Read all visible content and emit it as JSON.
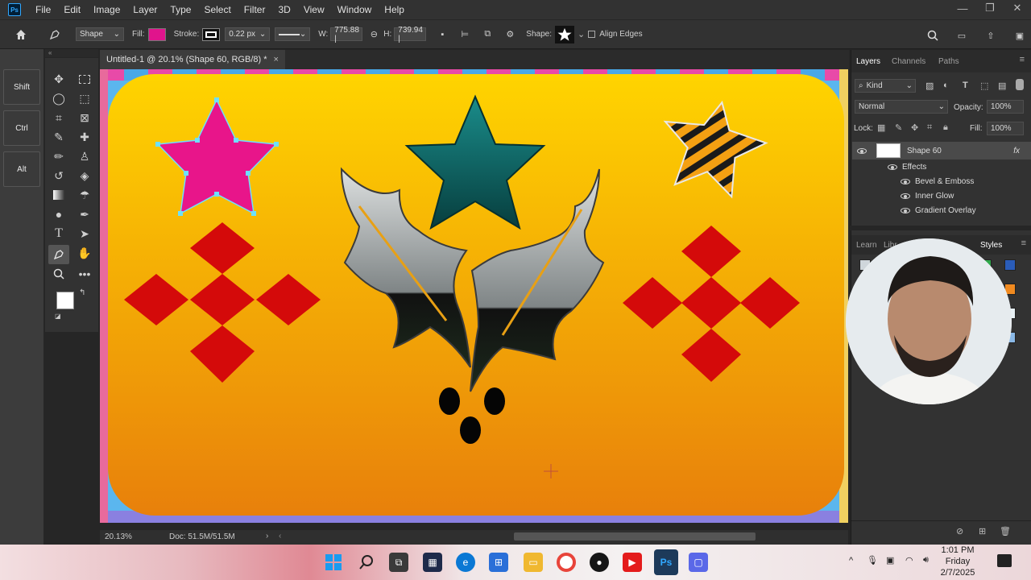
{
  "app": {
    "logo_text": "Ps",
    "menu": [
      "File",
      "Edit",
      "Image",
      "Layer",
      "Type",
      "Select",
      "Filter",
      "3D",
      "View",
      "Window",
      "Help"
    ],
    "window_controls": [
      "minimize",
      "restore",
      "close"
    ]
  },
  "options_bar": {
    "tool_mode": "Shape",
    "fill_label": "Fill:",
    "fill_color": "#e0148c",
    "stroke_label": "Stroke:",
    "stroke_width": "0.22 px",
    "width_label": "W:",
    "width_value": "775.88 |",
    "height_label": "H:",
    "height_value": "739.94 |",
    "shape_label": "Shape:",
    "align_edges_label": "Align Edges"
  },
  "keys": [
    "Shift",
    "Ctrl",
    "Alt"
  ],
  "document": {
    "tab_title": "Untitled-1 @ 20.1% (Shape 60, RGB/8) *",
    "zoom": "20.13%",
    "doc_info": "Doc: 51.5M/51.5M"
  },
  "layers_panel": {
    "tabs": [
      "Layers",
      "Channels",
      "Paths"
    ],
    "filter_kind": "Kind",
    "blend_mode": "Normal",
    "opacity_label": "Opacity:",
    "opacity_value": "100%",
    "lock_label": "Lock:",
    "fill_label": "Fill:",
    "fill_value": "100%",
    "layer_name": "Shape 60",
    "fx_label": "fx",
    "effects": [
      "Effects",
      "Bevel & Emboss",
      "Inner Glow",
      "Gradient Overlay"
    ]
  },
  "styles_panel": {
    "tabs": [
      "Learn",
      "Libr",
      "Styles"
    ]
  },
  "taskbar": {
    "time": "1:01 PM",
    "day": "Friday",
    "date": "2/7/2025"
  },
  "colors": {
    "canvas_top": "#ffd200",
    "canvas_bottom": "#e8820a",
    "pink_star": "#e8158a",
    "teal_star": "#0d5e5e",
    "diamond_red": "#d40a0a",
    "ps_blue": "#31a8ff"
  },
  "swatch_colors": [
    "#cfd6db",
    "#d01818",
    "#e9f2f4",
    "#f07020",
    "#f2f2f2",
    "#2fa84a",
    "#2a5cb8",
    "#94c43a",
    "#5a5a5a",
    "#2aa9c8",
    "#e4e0c8",
    "#1b8a2f",
    "#43b2e8",
    "#f08a20",
    "#f4f2b8",
    "#b0148c",
    "#e86a6a",
    "#2f6e2f",
    "#f2a818",
    "#ee7a20",
    "#e7f0f4",
    "#34b0e0",
    "#e8158a",
    "#e8eef0",
    "#f0a020",
    "#2a8ad0",
    "#3a8e2e",
    "#8ab8e6",
    "#23a84a",
    "#f2b040",
    "#4a4a4a",
    "#c8e0e8"
  ]
}
